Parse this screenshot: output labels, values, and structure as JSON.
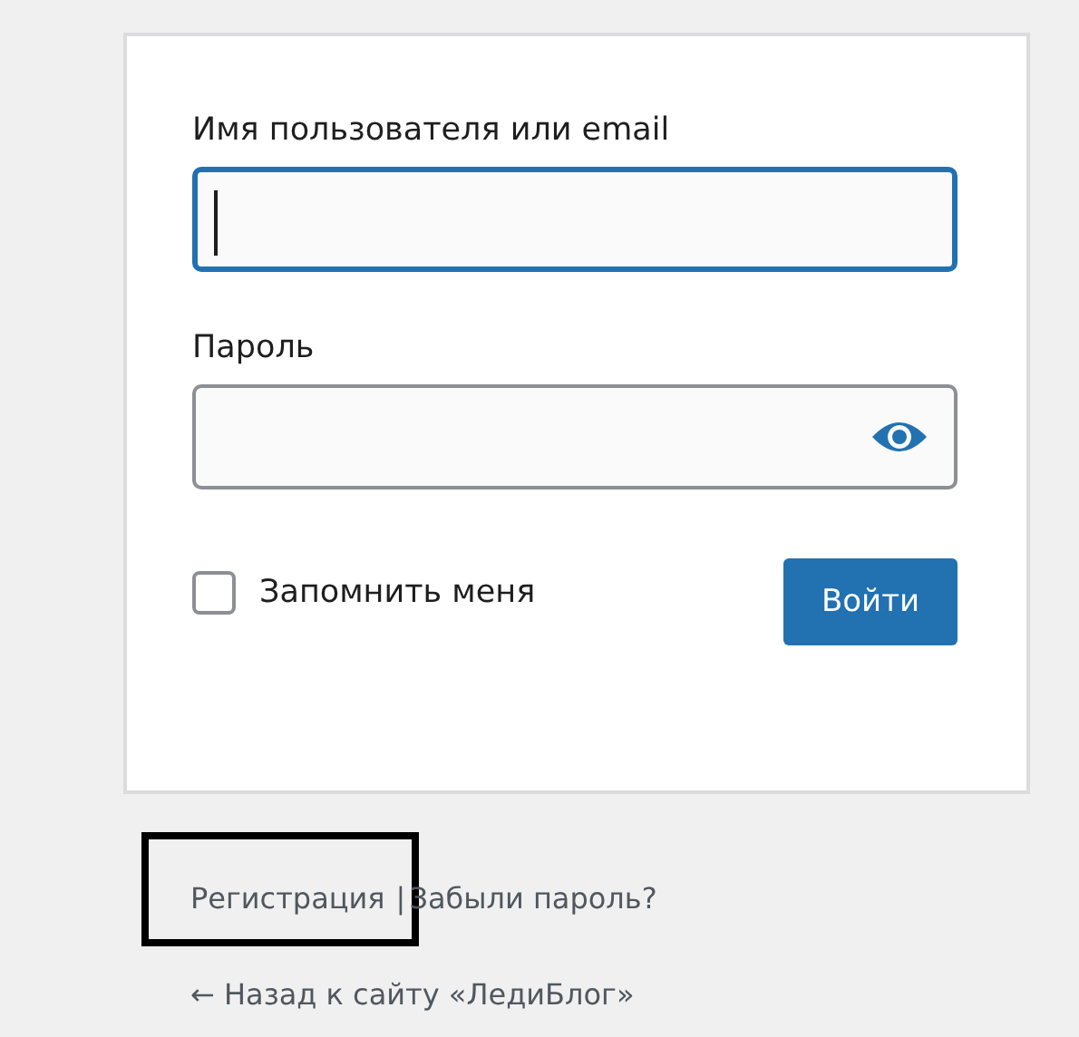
{
  "login_form": {
    "fields": [
      {
        "label": "Имя пользователя или email",
        "kind": "text",
        "focused": true
      },
      {
        "label": "Пароль",
        "kind": "password",
        "focused": false
      }
    ],
    "remember_me": {
      "label": "Запомнить меня",
      "checked": false
    },
    "submit_button": "Войти"
  },
  "nav_links": [
    {
      "label": "Регистрация",
      "highlighted": true
    },
    {
      "label": "Забыли пароль?",
      "highlighted": false
    }
  ],
  "nav_separator": "|",
  "back_link": "← Назад к сайту «ЛедиБлог»"
}
